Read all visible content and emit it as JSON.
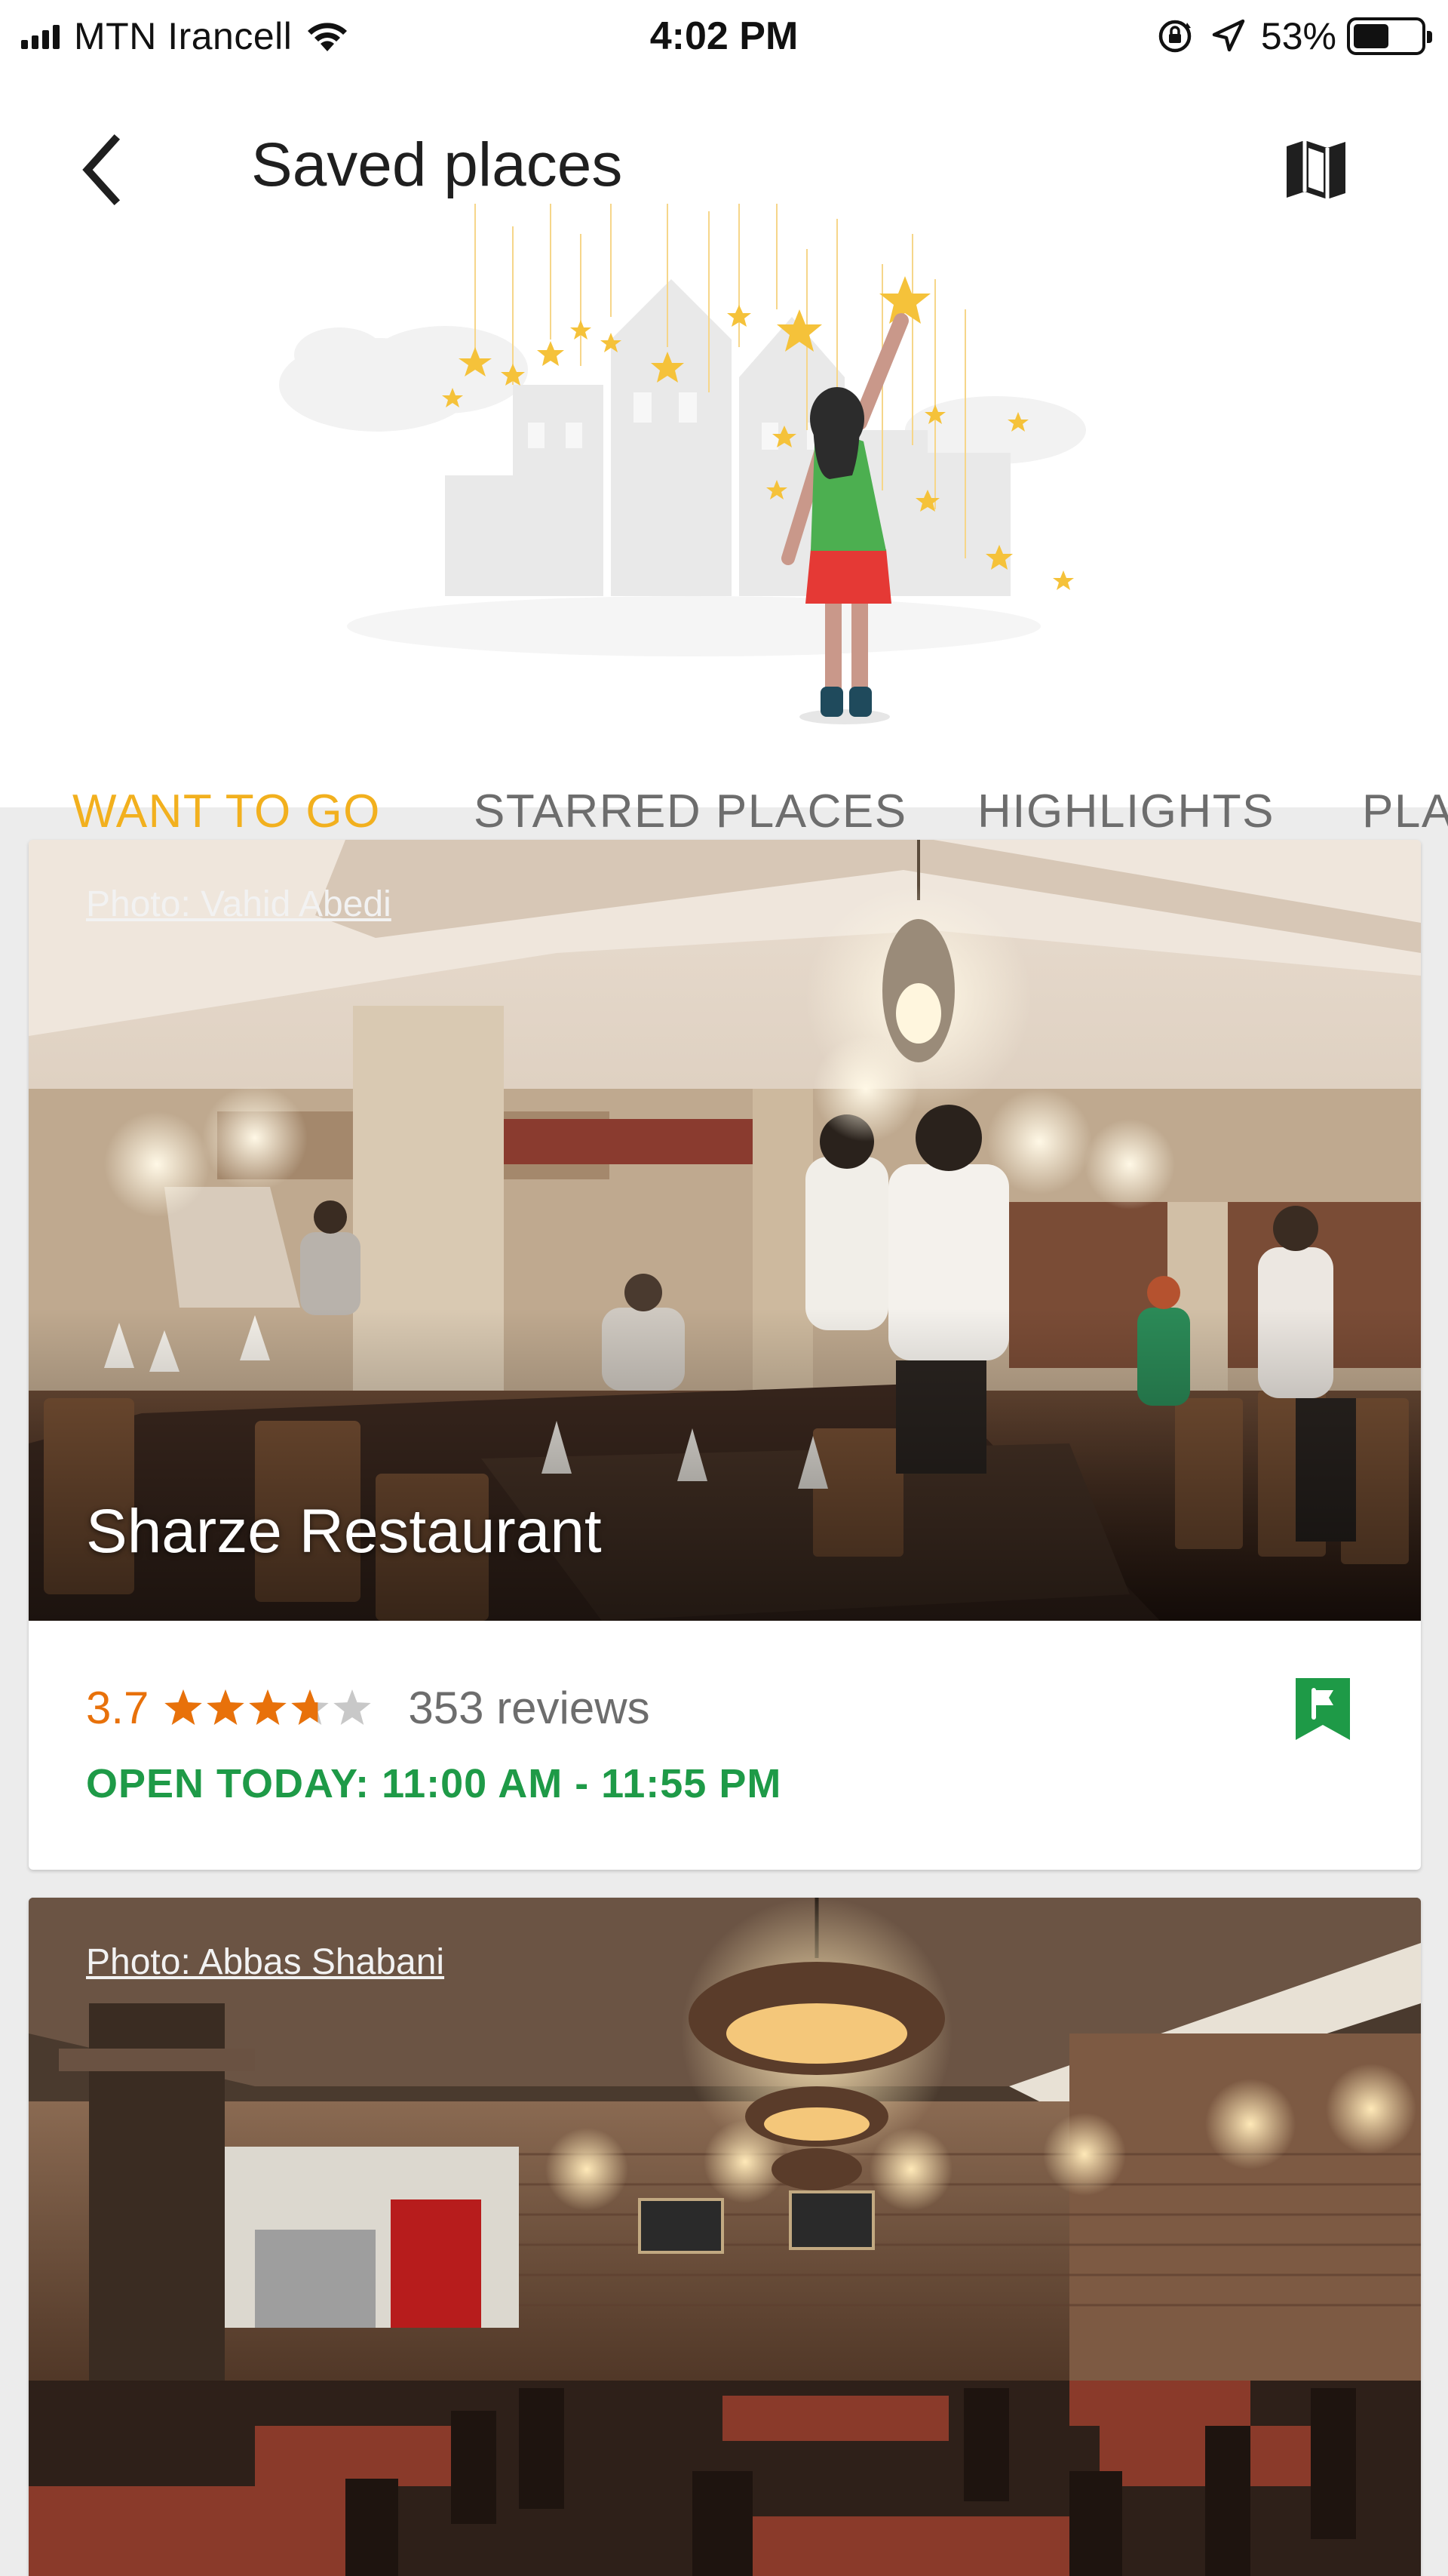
{
  "status_bar": {
    "carrier": "MTN Irancell",
    "time": "4:02 PM",
    "battery_percent": "53%",
    "battery_level": 0.53,
    "icons": [
      "signal-icon",
      "wifi-icon",
      "orientation-lock-icon",
      "location-arrow-icon",
      "battery-icon"
    ]
  },
  "header": {
    "title": "Saved places",
    "back_icon": "chevron-left-icon",
    "map_icon": "map-icon"
  },
  "tabs": [
    {
      "label": "WANT TO GO",
      "active": true
    },
    {
      "label": "STARRED PLACES",
      "active": false
    },
    {
      "label": "HIGHLIGHTS",
      "active": false
    },
    {
      "label": "PLA",
      "active": false
    }
  ],
  "places": [
    {
      "photo_credit": "Photo: Vahid Abedi",
      "name": "Sharze Restaurant",
      "rating": "3.7",
      "rating_value": 3.7,
      "reviews": "353 reviews",
      "hours": "OPEN TODAY: 11:00 AM - 11:55 PM",
      "saved_icon": "want-to-go-flag-icon"
    },
    {
      "photo_credit": "Photo: Abbas Shabani",
      "name": "",
      "rating": "",
      "reviews": "",
      "hours": ""
    }
  ],
  "colors": {
    "accent_tab": "#f2b01e",
    "rating": "#e8710a",
    "open_hours": "#1e9a47",
    "saved_flag": "#1e9a47",
    "background": "#ececec"
  }
}
